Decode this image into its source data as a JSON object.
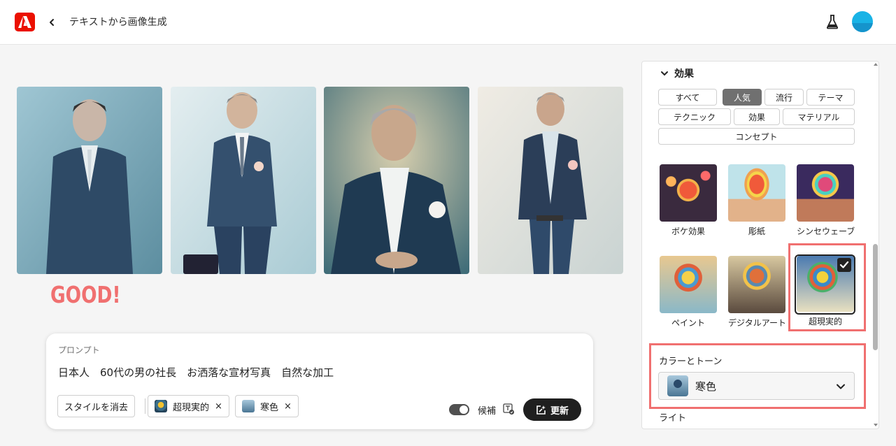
{
  "app": {
    "title": "テキストから画像生成",
    "brand_color": "#eb1000"
  },
  "header": {
    "back_icon": "chevron-left-icon",
    "labs_icon": "flask-icon",
    "avatar_icon": "user-avatar"
  },
  "results": {
    "images": [
      {
        "desc": "generated-portrait-1"
      },
      {
        "desc": "generated-portrait-2"
      },
      {
        "desc": "generated-portrait-3"
      },
      {
        "desc": "generated-portrait-4"
      }
    ],
    "annotation": "GOOD!"
  },
  "prompt": {
    "label": "プロンプト",
    "text": "日本人　60代の男の社長　お洒落な宣材写真　自然な加工",
    "clear_style_label": "スタイルを消去",
    "chips": [
      {
        "label": "超現実的",
        "remove": "×"
      },
      {
        "label": "寒色",
        "remove": "×"
      }
    ],
    "candidates_label": "候補",
    "update_label": "更新"
  },
  "effects": {
    "section_title": "効果",
    "filter_tabs": [
      "すべて",
      "人気",
      "流行",
      "テーマ",
      "テクニック",
      "効果",
      "マテリアル",
      "コンセプト"
    ],
    "active_tab": "人気",
    "styles": [
      {
        "label": "ボケ効果",
        "selected": false
      },
      {
        "label": "彫紙",
        "selected": false
      },
      {
        "label": "シンセウェーブ",
        "selected": false
      },
      {
        "label": "ペイント",
        "selected": false
      },
      {
        "label": "デジタルアート",
        "selected": false
      },
      {
        "label": "超現実的",
        "selected": true
      }
    ]
  },
  "color_tone": {
    "label": "カラーとトーン",
    "selected": "寒色"
  },
  "light": {
    "label": "ライト"
  },
  "colors": {
    "highlight": "#f07070",
    "button_dark": "#1f1f1f"
  }
}
